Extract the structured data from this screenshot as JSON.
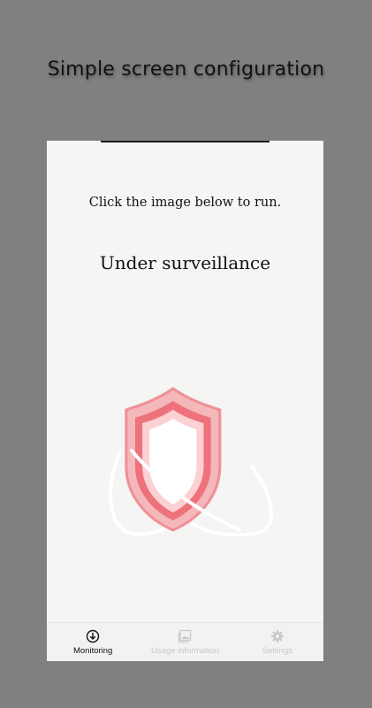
{
  "headline": "Simple screen configuration",
  "screen": {
    "instruction": "Click the image below to run.",
    "status_title": "Under surveillance"
  },
  "shield": {
    "icon": "shield-icon",
    "outer_color": "#f2a0a4",
    "inner_color": "#ee6f78",
    "ring_color": "#ffffff"
  },
  "bottom_nav": {
    "items": [
      {
        "label": "Monitoring",
        "icon": "download-circle-icon",
        "active": true
      },
      {
        "label": "Usage information",
        "icon": "image-icon",
        "active": false
      },
      {
        "label": "Settings",
        "icon": "gear-icon",
        "active": false
      }
    ]
  },
  "colors": {
    "background": "#808080",
    "screen": "#f5f5f3",
    "active": "#111111",
    "inactive": "#c8c8c6"
  }
}
